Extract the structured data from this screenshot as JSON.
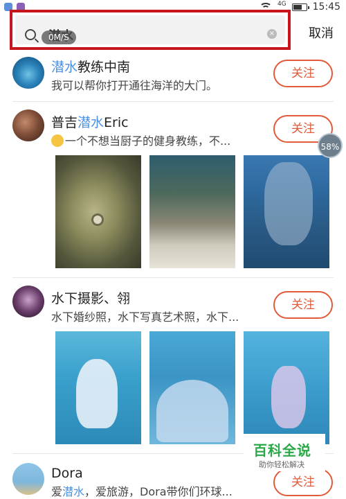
{
  "status": {
    "network": "4G",
    "time": "15:45"
  },
  "search": {
    "query": "潜水",
    "speed": "0M/S",
    "cancel": "取消"
  },
  "overlay": {
    "progress": "58%"
  },
  "results": [
    {
      "name_hl": "潜水",
      "name_rest": "教练中南",
      "desc": "我可以帮你打开通往海洋的大门。",
      "follow": "关注"
    },
    {
      "name_pre": "普吉",
      "name_hl": "潜水",
      "name_rest": "Eric",
      "desc": "一个不想当厨子的健身教练，不...",
      "follow": "关注"
    },
    {
      "name": "水下摄影、翎",
      "desc": "水下婚纱照，水下写真艺术照，水下...",
      "follow": "关注"
    },
    {
      "name": "Dora",
      "desc_pre": "爱",
      "desc_hl": "潜水",
      "desc_rest": "，爱旅游，Dora带你们环球...",
      "follow": "关注"
    }
  ],
  "watermark": {
    "title": "百科全说",
    "subtitle": "助你轻松解决"
  }
}
